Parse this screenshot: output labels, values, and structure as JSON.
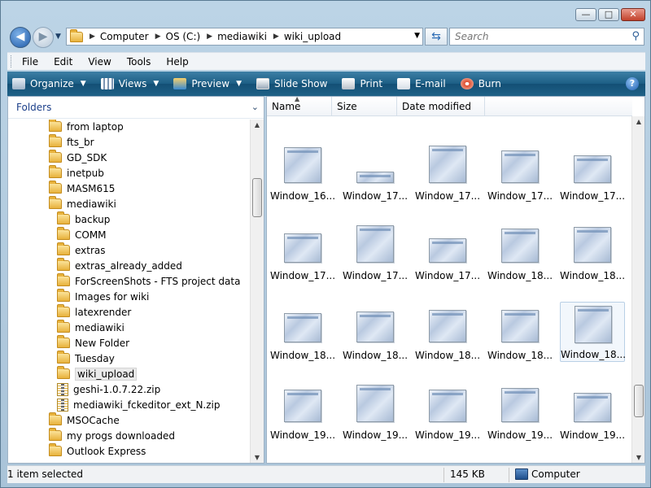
{
  "window": {
    "minimize_glyph": "—",
    "maximize_glyph": "□",
    "close_glyph": "✕"
  },
  "nav": {
    "back_glyph": "◀",
    "forward_glyph": "▶",
    "breadcrumb": [
      "Computer",
      "OS (C:)",
      "mediawiki",
      "wiki_upload"
    ],
    "search_placeholder": "Search"
  },
  "menu": [
    "File",
    "Edit",
    "View",
    "Tools",
    "Help"
  ],
  "toolbar": {
    "organize": "Organize",
    "views": "Views",
    "preview": "Preview",
    "slideshow": "Slide Show",
    "print": "Print",
    "email": "E-mail",
    "burn": "Burn",
    "help": "?"
  },
  "tree": {
    "header": "Folders",
    "items": [
      {
        "label": "from laptop",
        "depth": 0,
        "icon": "folder"
      },
      {
        "label": "fts_br",
        "depth": 0,
        "icon": "folder"
      },
      {
        "label": "GD_SDK",
        "depth": 0,
        "icon": "folder"
      },
      {
        "label": "inetpub",
        "depth": 0,
        "icon": "folder"
      },
      {
        "label": "MASM615",
        "depth": 0,
        "icon": "folder"
      },
      {
        "label": "mediawiki",
        "depth": 0,
        "icon": "folder"
      },
      {
        "label": "backup",
        "depth": 1,
        "icon": "folder"
      },
      {
        "label": "COMM",
        "depth": 1,
        "icon": "folder"
      },
      {
        "label": "extras",
        "depth": 1,
        "icon": "folder"
      },
      {
        "label": "extras_already_added",
        "depth": 1,
        "icon": "folder"
      },
      {
        "label": "ForScreenShots - FTS project data",
        "depth": 1,
        "icon": "folder"
      },
      {
        "label": "Images for wiki",
        "depth": 1,
        "icon": "folder"
      },
      {
        "label": "latexrender",
        "depth": 1,
        "icon": "folder"
      },
      {
        "label": "mediawiki",
        "depth": 1,
        "icon": "folder"
      },
      {
        "label": "New Folder",
        "depth": 1,
        "icon": "folder"
      },
      {
        "label": "Tuesday",
        "depth": 1,
        "icon": "folder"
      },
      {
        "label": "wiki_upload",
        "depth": 1,
        "icon": "folder",
        "selected": true
      },
      {
        "label": "geshi-1.0.7.22.zip",
        "depth": 1,
        "icon": "zip"
      },
      {
        "label": "mediawiki_fckeditor_ext_N.zip",
        "depth": 1,
        "icon": "zip"
      },
      {
        "label": "MSOCache",
        "depth": 0,
        "icon": "folder"
      },
      {
        "label": "my progs downloaded",
        "depth": 0,
        "icon": "folder"
      },
      {
        "label": "Outlook Express",
        "depth": 0,
        "icon": "folder"
      }
    ]
  },
  "columns": [
    "Name",
    "Size",
    "Date modified"
  ],
  "files": [
    {
      "name": "Window_16...",
      "selected": false
    },
    {
      "name": "Window_17...",
      "selected": false
    },
    {
      "name": "Window_17...",
      "selected": false
    },
    {
      "name": "Window_17...",
      "selected": false
    },
    {
      "name": "Window_17...",
      "selected": false
    },
    {
      "name": "Window_17...",
      "selected": false
    },
    {
      "name": "Window_17...",
      "selected": false
    },
    {
      "name": "Window_17...",
      "selected": false
    },
    {
      "name": "Window_18...",
      "selected": false
    },
    {
      "name": "Window_18...",
      "selected": false
    },
    {
      "name": "Window_18...",
      "selected": false
    },
    {
      "name": "Window_18...",
      "selected": false
    },
    {
      "name": "Window_18...",
      "selected": false
    },
    {
      "name": "Window_18...",
      "selected": false
    },
    {
      "name": "Window_18...",
      "selected": true
    },
    {
      "name": "Window_19...",
      "selected": false
    },
    {
      "name": "Window_19...",
      "selected": false
    },
    {
      "name": "Window_19...",
      "selected": false
    },
    {
      "name": "Window_19...",
      "selected": false
    },
    {
      "name": "Window_19...",
      "selected": false
    }
  ],
  "status": {
    "selection": "1 item selected",
    "size": "145 KB",
    "location": "Computer"
  }
}
